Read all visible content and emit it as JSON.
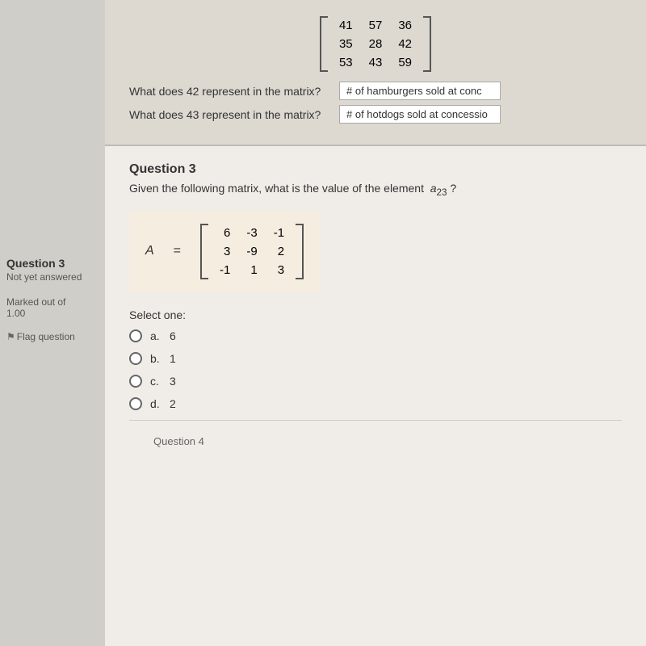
{
  "sidebar": {
    "question_label": "Question 3",
    "status": "Not yet answered",
    "marked_label": "Marked out of",
    "marked_value": "1.00",
    "flag_label": "Flag question"
  },
  "top_section": {
    "matrix": {
      "rows": [
        [
          "41",
          "57",
          "36"
        ],
        [
          "35",
          "28",
          "42"
        ],
        [
          "53",
          "43",
          "59"
        ]
      ]
    },
    "q1_label": "What does 42 represent in the matrix?",
    "q1_answer": "# of hamburgers sold at conc",
    "q2_label": "What does 43 represent in the matrix?",
    "q2_answer": "# of hotdogs sold at concessio"
  },
  "question3": {
    "header": "Question 3",
    "question_text": "Given the following matrix, what is the value of the element  a₂₃ ?",
    "matrix_label": "A",
    "matrix": {
      "rows": [
        [
          "6",
          "-3",
          "-1"
        ],
        [
          "3",
          "-9",
          "2"
        ],
        [
          "-1",
          "1",
          "3"
        ]
      ]
    },
    "select_label": "Select one:",
    "options": [
      {
        "letter": "a.",
        "value": "6"
      },
      {
        "letter": "b.",
        "value": "1"
      },
      {
        "letter": "c.",
        "value": "3"
      },
      {
        "letter": "d.",
        "value": "2"
      }
    ]
  },
  "bottom": {
    "label": "Question 4"
  }
}
